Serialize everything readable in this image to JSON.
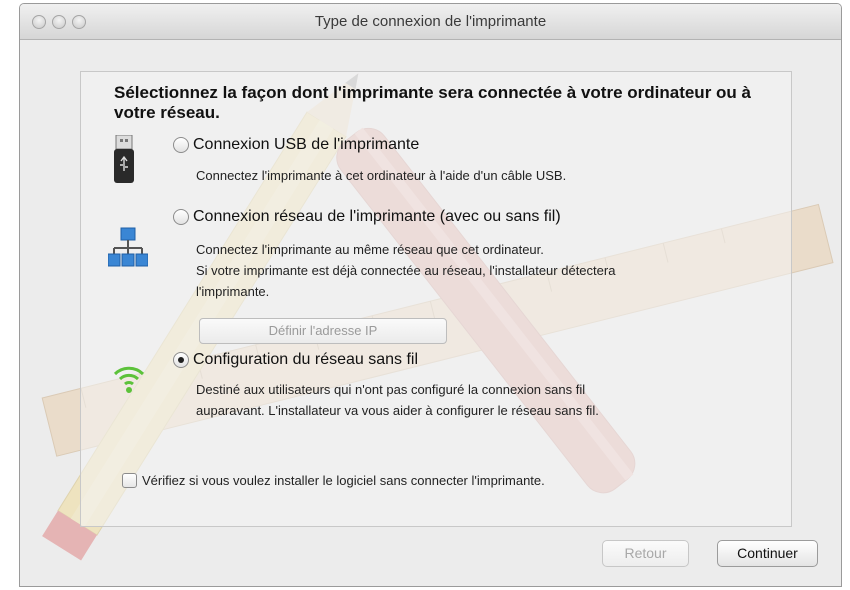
{
  "window": {
    "title": "Type de connexion de l'imprimante"
  },
  "heading": "Sélectionnez la façon dont l'imprimante sera connectée à votre ordinateur ou à votre réseau.",
  "options": [
    {
      "label": "Connexion USB de l'imprimante",
      "description": "Connectez l'imprimante à cet ordinateur à l'aide d'un câble USB.",
      "icon": "usb-drive-icon",
      "selected": false
    },
    {
      "label": "Connexion réseau de l'imprimante (avec ou sans fil)",
      "description_lines": [
        "Connectez l'imprimante au même réseau que cet ordinateur.",
        "Si votre imprimante est déjà connectée au réseau, l'installateur détectera",
        "l'imprimante."
      ],
      "icon": "network-icon",
      "selected": false,
      "ip_button_label": "Définir l'adresse IP"
    },
    {
      "label": "Configuration du réseau sans fil",
      "description_lines": [
        "Destiné aux utilisateurs qui n'ont pas configuré la connexion sans fil",
        "auparavant. L'installateur va vous aider à configurer le réseau sans fil."
      ],
      "icon": "wifi-icon",
      "selected": true
    }
  ],
  "checkbox_label": "Vérifiez si vous voulez installer le logiciel sans connecter l'imprimante.",
  "buttons": {
    "back": "Retour",
    "continue": "Continuer"
  }
}
